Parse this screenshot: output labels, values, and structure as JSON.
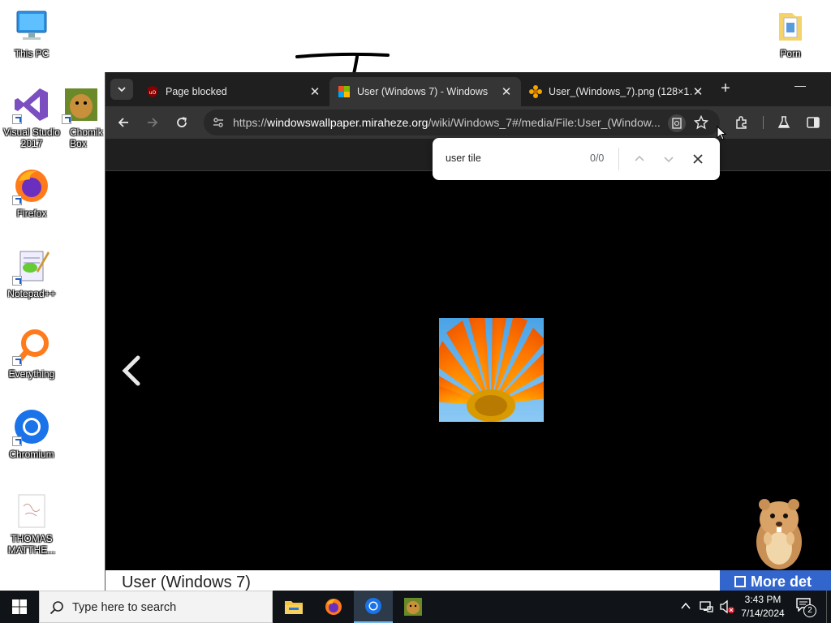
{
  "desktop": {
    "icons": [
      {
        "label": "This PC"
      },
      {
        "label": "Visual Studio 2017"
      },
      {
        "label": "ChomikBox"
      },
      {
        "label": "Firefox"
      },
      {
        "label": "Notepad++"
      },
      {
        "label": "Everything"
      },
      {
        "label": "Chromium"
      },
      {
        "label": "THOMAS MATTHE..."
      },
      {
        "label": "Porn"
      }
    ]
  },
  "browser": {
    "tabs": [
      {
        "title": "Page blocked",
        "favicon": "ublock-icon"
      },
      {
        "title": "User (Windows 7) - Windows",
        "favicon": "wiki-icon"
      },
      {
        "title": "User_(Windows_7).png (128×1…",
        "favicon": "flower-icon"
      }
    ],
    "url_prefix": "https://",
    "url_domain": "windowswallpaper.miraheze.org",
    "url_path": "/wiki/Windows_7#/media/File:User_(Window...",
    "caption": "User (Windows 7)",
    "more_button": "More det"
  },
  "findbar": {
    "query": "user tile",
    "count": "0/0"
  },
  "taskbar": {
    "search_placeholder": "Type here to search",
    "time": "3:43 PM",
    "date": "7/14/2024",
    "notification_count": "2"
  },
  "colors": {
    "browser_dark": "#1f1f1f",
    "toolbar": "#353535",
    "accent_blue": "#3366cc",
    "taskbar": "#101418"
  }
}
